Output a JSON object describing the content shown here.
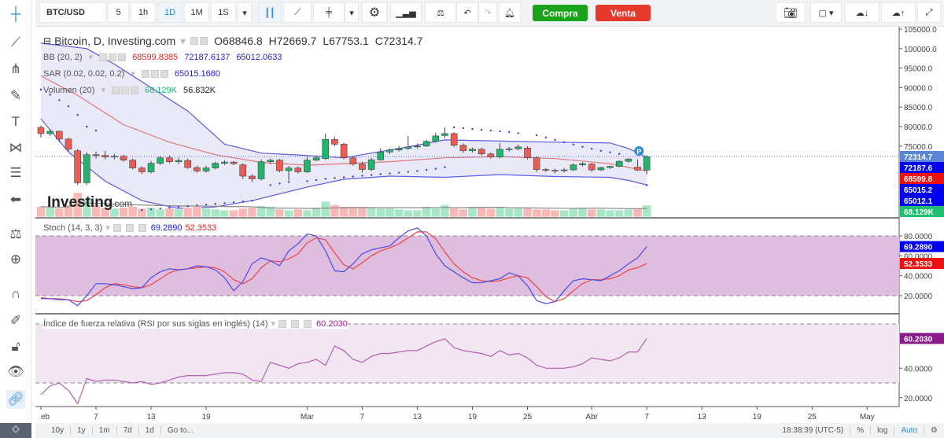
{
  "toolbar": {
    "symbol": "BTC/USD",
    "intervals": [
      "5",
      "1h",
      "1D",
      "1M",
      "1S"
    ],
    "active_interval": "1D",
    "buy_label": "Compra",
    "sell_label": "Venta"
  },
  "legend": {
    "title": "Bitcoin, D, Investing.com",
    "open": "O68846.8",
    "high": "H72669.7",
    "low": "L67753.1",
    "close": "C72314.7",
    "bb": {
      "label": "BB (20, 2)",
      "middle": "68599.8385",
      "upper": "72187.6137",
      "lower": "65012.0633"
    },
    "sar": {
      "label": "SAR (0.02, 0.02, 0.2)",
      "value": "65015.1680"
    },
    "volume": {
      "label": "Volumen (20)",
      "value": "68.129K",
      "ma": "56.832K"
    }
  },
  "stoch": {
    "label": "Stoch (14, 3, 3)",
    "k": "69.2890",
    "d": "52.3533",
    "axis": [
      "80.0000",
      "60.0000",
      "40.0000",
      "20.0000"
    ]
  },
  "rsi": {
    "label": "Índice de fuerza relativa (RSI por sus siglas en inglés) (14)",
    "value": "60.2030",
    "axis": [
      "40.0000",
      "20.0000"
    ]
  },
  "price_axis": {
    "ticks": [
      "105000.0",
      "100000.0",
      "95000.0",
      "90000.0",
      "85000.0",
      "80000.0",
      "75000.0"
    ],
    "labels": [
      {
        "text": "72314.7",
        "value": 72314.7,
        "color": "#5b86d8"
      },
      {
        "text": "72187.6",
        "value": 72187.6,
        "color": "#0000ee"
      },
      {
        "text": "68599.8",
        "value": 68599.8,
        "color": "#ee1111"
      },
      {
        "text": "65015.2",
        "value": 65015.2,
        "color": "#0000ee"
      },
      {
        "text": "65012.1",
        "value": 65012.1,
        "color": "#0000ee"
      }
    ],
    "volume_label": {
      "text": "68.129K",
      "color": "#1fbf72"
    }
  },
  "date_axis": [
    {
      "label": "eb",
      "date": "Feb 1"
    },
    {
      "label": "7",
      "date": "Feb 7"
    },
    {
      "label": "13",
      "date": "Feb 13"
    },
    {
      "label": "19",
      "date": "Feb 19"
    },
    {
      "label": "Mar",
      "date": "Mar 1"
    },
    {
      "label": "7",
      "date": "Mar 7"
    },
    {
      "label": "13",
      "date": "Mar 13"
    },
    {
      "label": "19",
      "date": "Mar 19"
    },
    {
      "label": "25",
      "date": "Mar 25"
    },
    {
      "label": "Abr",
      "date": "Apr 1"
    },
    {
      "label": "7",
      "date": "Apr 7"
    },
    {
      "label": "13",
      "date": "Apr 13"
    },
    {
      "label": "19",
      "date": "Apr 19"
    },
    {
      "label": "25",
      "date": "Apr 25"
    },
    {
      "label": "May",
      "date": "May 1"
    }
  ],
  "bottom": {
    "ranges": [
      "10y",
      "1y",
      "1m",
      "7d",
      "1d",
      "Go to..."
    ],
    "time": "18:38:39 (UTC-5)",
    "percent": "%",
    "log": "log",
    "auto": "Auto"
  },
  "colors": {
    "up": "#21b46b",
    "down": "#ee5b55",
    "bb_band": "#5a5ae6",
    "bb_mid": "#e07a7a",
    "sar": "#3a3adf",
    "stoch_k": "#4a4ae8",
    "stoch_d": "#ee4444",
    "rsi": "#b060b0"
  },
  "chart_data": {
    "type": "candlestick",
    "candles": [
      [
        "Feb 1",
        79800,
        80300,
        77200,
        78200
      ],
      [
        "Feb 2",
        78200,
        79400,
        77600,
        78800
      ],
      [
        "Feb 3",
        78800,
        79000,
        76000,
        76800
      ],
      [
        "Feb 4",
        76800,
        77200,
        73400,
        74200
      ],
      [
        "Feb 5",
        73800,
        74200,
        65000,
        65600
      ],
      [
        "Feb 6",
        65600,
        73400,
        65000,
        72800
      ],
      [
        "Feb 7",
        72800,
        73600,
        71800,
        72600
      ],
      [
        "Feb 8",
        72600,
        73800,
        71600,
        72200
      ],
      [
        "Feb 9",
        72200,
        73000,
        71600,
        72400
      ],
      [
        "Feb 10",
        72400,
        72800,
        71000,
        71400
      ],
      [
        "Feb 11",
        71400,
        71800,
        69000,
        69400
      ],
      [
        "Feb 12",
        69400,
        69800,
        67800,
        68400
      ],
      [
        "Feb 13",
        68400,
        71200,
        68000,
        70600
      ],
      [
        "Feb 14",
        70600,
        72400,
        70200,
        72000
      ],
      [
        "Feb 15",
        72000,
        72600,
        70600,
        71000
      ],
      [
        "Feb 16",
        71000,
        72000,
        70400,
        71300
      ],
      [
        "Feb 17",
        71300,
        71800,
        69200,
        69500
      ],
      [
        "Feb 18",
        69500,
        70000,
        68200,
        68600
      ],
      [
        "Feb 19",
        68600,
        70000,
        68200,
        69400
      ],
      [
        "Feb 20",
        69400,
        71000,
        69000,
        70600
      ],
      [
        "Feb 21",
        70600,
        71400,
        70200,
        70900
      ],
      [
        "Feb 22",
        70900,
        71200,
        70100,
        70500
      ],
      [
        "Feb 23",
        70200,
        70600,
        66600,
        67300
      ],
      [
        "Feb 24",
        67300,
        67800,
        65800,
        66600
      ],
      [
        "Feb 25",
        66600,
        71600,
        66200,
        71000
      ],
      [
        "Feb 26",
        71000,
        71800,
        70400,
        71400
      ],
      [
        "Feb 27",
        71400,
        71700,
        68300,
        68700
      ],
      [
        "Feb 28",
        68700,
        69900,
        66200,
        69400
      ],
      [
        "Feb 29",
        69400,
        69800,
        68000,
        68400
      ],
      [
        "Mar 1",
        68400,
        72400,
        68100,
        71400
      ],
      [
        "Mar 2",
        71400,
        72600,
        71200,
        72000
      ],
      [
        "Mar 3",
        71800,
        78200,
        71400,
        76700
      ],
      [
        "Mar 4",
        76700,
        77400,
        75000,
        75500
      ],
      [
        "Mar 5",
        75500,
        75900,
        71600,
        72000
      ],
      [
        "Mar 6",
        72000,
        72400,
        70000,
        70400
      ],
      [
        "Mar 7",
        70400,
        71000,
        68200,
        69000
      ],
      [
        "Mar 8",
        69000,
        72000,
        68600,
        71500
      ],
      [
        "Mar 9",
        71500,
        74400,
        71200,
        73500
      ],
      [
        "Mar 10",
        73500,
        74400,
        73000,
        74000
      ],
      [
        "Mar 11",
        74000,
        75000,
        73600,
        74400
      ],
      [
        "Mar 12",
        74400,
        77600,
        74000,
        74800
      ],
      [
        "Mar 13",
        74800,
        75600,
        74400,
        75000
      ],
      [
        "Mar 14",
        75000,
        76600,
        74800,
        76200
      ],
      [
        "Mar 15",
        76200,
        78400,
        76000,
        77600
      ],
      [
        "Mar 16",
        77700,
        79800,
        77000,
        78200
      ],
      [
        "Mar 17",
        78200,
        78600,
        74800,
        75200
      ],
      [
        "Mar 18",
        75200,
        75600,
        73200,
        73800
      ],
      [
        "Mar 19",
        73800,
        74600,
        73400,
        74200
      ],
      [
        "Mar 20",
        74200,
        74600,
        72600,
        73000
      ],
      [
        "Mar 21",
        73000,
        73400,
        71800,
        72200
      ],
      [
        "Mar 22",
        72200,
        75800,
        71800,
        74200
      ],
      [
        "Mar 23",
        74200,
        74800,
        73600,
        74300
      ],
      [
        "Mar 24",
        74300,
        75400,
        74000,
        74800
      ],
      [
        "Mar 25",
        74500,
        75000,
        71600,
        72000
      ],
      [
        "Mar 26",
        72000,
        72400,
        68400,
        69000
      ],
      [
        "Mar 27",
        69000,
        69400,
        68400,
        68800
      ],
      [
        "Mar 28",
        68800,
        69200,
        68000,
        68700
      ],
      [
        "Mar 29",
        68700,
        69400,
        68200,
        68900
      ],
      [
        "Mar 30",
        68900,
        70600,
        68600,
        70200
      ],
      [
        "Mar 31",
        70200,
        70900,
        69800,
        70500
      ],
      [
        "Apr 1",
        70400,
        70700,
        68400,
        68900
      ],
      [
        "Apr 2",
        68900,
        69700,
        68700,
        69500
      ],
      [
        "Apr 3",
        69500,
        70000,
        69200,
        69800
      ],
      [
        "Apr 4",
        69800,
        71400,
        69600,
        71100
      ],
      [
        "Apr 5",
        71100,
        71900,
        70800,
        71700
      ],
      [
        "Apr 6",
        69600,
        71600,
        68600,
        68850
      ],
      [
        "Apr 7",
        68846.8,
        72669.7,
        67753.1,
        72314.7
      ]
    ],
    "volume_k": [
      60,
      55,
      50,
      70,
      140,
      110,
      70,
      55,
      50,
      55,
      60,
      50,
      55,
      45,
      50,
      45,
      55,
      60,
      50,
      45,
      40,
      40,
      50,
      55,
      65,
      60,
      45,
      40,
      45,
      40,
      55,
      90,
      70,
      60,
      60,
      60,
      55,
      50,
      50,
      45,
      40,
      40,
      60,
      50,
      70,
      50,
      45,
      60,
      55,
      50,
      60,
      50,
      50,
      55,
      45,
      45,
      40,
      40,
      50,
      55,
      45,
      45,
      40,
      40,
      45,
      50,
      68.129
    ],
    "bb_upper": [
      [
        "Feb 1",
        101400
      ],
      [
        "Feb 6",
        100000
      ],
      [
        "Feb 9",
        96000
      ],
      [
        "Feb 13",
        90000
      ],
      [
        "Feb 17",
        84000
      ],
      [
        "Feb 21",
        75500
      ],
      [
        "Feb 25",
        73200
      ],
      [
        "Mar 1",
        72600
      ],
      [
        "Mar 5",
        72000
      ],
      [
        "Mar 8",
        73200
      ],
      [
        "Mar 12",
        74800
      ],
      [
        "Mar 16",
        76600
      ],
      [
        "Mar 22",
        76300
      ],
      [
        "Mar 28",
        76000
      ],
      [
        "Apr 3",
        75800
      ],
      [
        "Apr 5",
        74400
      ],
      [
        "Apr 7",
        72187.6
      ]
    ],
    "bb_middle": [
      [
        "Feb 1",
        93000
      ],
      [
        "Feb 5",
        88000
      ],
      [
        "Feb 10",
        80500
      ],
      [
        "Feb 15",
        76000
      ],
      [
        "Feb 20",
        72800
      ],
      [
        "Feb 25",
        70800
      ],
      [
        "Mar 1",
        70100
      ],
      [
        "Mar 5",
        70500
      ],
      [
        "Mar 10",
        71000
      ],
      [
        "Mar 16",
        72000
      ],
      [
        "Mar 22",
        72300
      ],
      [
        "Mar 28",
        71800
      ],
      [
        "Apr 3",
        70500
      ],
      [
        "Apr 7",
        68599.8
      ]
    ],
    "bb_lower": [
      [
        "Feb 1",
        82000
      ],
      [
        "Feb 4",
        73500
      ],
      [
        "Feb 8",
        66000
      ],
      [
        "Feb 12",
        61000
      ],
      [
        "Feb 16",
        59000
      ],
      [
        "Feb 20",
        59400
      ],
      [
        "Feb 24",
        61000
      ],
      [
        "Mar 1",
        64500
      ],
      [
        "Mar 5",
        66500
      ],
      [
        "Mar 10",
        67300
      ],
      [
        "Mar 16",
        67000
      ],
      [
        "Mar 22",
        67700
      ],
      [
        "Mar 28",
        67200
      ],
      [
        "Apr 3",
        67000
      ],
      [
        "Apr 5",
        66200
      ],
      [
        "Apr 7",
        65012.1
      ]
    ],
    "sar": [
      [
        "Feb 1",
        89500
      ],
      [
        "Feb 2",
        88200
      ],
      [
        "Feb 3",
        86800
      ],
      [
        "Feb 4",
        85200
      ],
      [
        "Feb 5",
        83000
      ],
      [
        "Feb 6",
        80000
      ],
      [
        "Feb 7",
        79000
      ],
      [
        "Feb 12",
        58600
      ],
      [
        "Feb 13",
        58800
      ],
      [
        "Feb 14",
        59000
      ],
      [
        "Feb 15",
        59200
      ],
      [
        "Feb 16",
        59400
      ],
      [
        "Feb 17",
        59600
      ],
      [
        "Feb 18",
        59800
      ],
      [
        "Feb 19",
        60000
      ],
      [
        "Feb 20",
        60200
      ],
      [
        "Feb 21",
        60400
      ],
      [
        "Feb 22",
        60600
      ],
      [
        "Feb 23",
        60800
      ],
      [
        "Feb 24",
        61000
      ],
      [
        "Feb 26",
        65000
      ],
      [
        "Feb 27",
        65400
      ],
      [
        "Feb 28",
        65800
      ],
      [
        "Mar 1",
        66000
      ],
      [
        "Mar 2",
        66300
      ],
      [
        "Mar 3",
        66600
      ],
      [
        "Mar 4",
        66800
      ],
      [
        "Mar 5",
        67000
      ],
      [
        "Mar 6",
        67200
      ],
      [
        "Mar 7",
        67400
      ],
      [
        "Mar 8",
        67600
      ],
      [
        "Mar 9",
        67800
      ],
      [
        "Mar 10",
        68000
      ],
      [
        "Mar 11",
        68200
      ],
      [
        "Mar 12",
        68400
      ],
      [
        "Mar 13",
        68600
      ],
      [
        "Mar 14",
        68900
      ],
      [
        "Mar 15",
        69200
      ],
      [
        "Mar 16",
        69600
      ],
      [
        "Mar 17",
        79800
      ],
      [
        "Mar 18",
        79600
      ],
      [
        "Mar 19",
        79400
      ],
      [
        "Mar 20",
        79200
      ],
      [
        "Mar 21",
        79000
      ],
      [
        "Mar 22",
        78800
      ],
      [
        "Mar 23",
        78600
      ],
      [
        "Mar 24",
        78300
      ],
      [
        "Mar 26",
        77800
      ],
      [
        "Mar 27",
        77200
      ],
      [
        "Mar 28",
        76600
      ],
      [
        "Mar 29",
        76000
      ],
      [
        "Mar 30",
        75400
      ],
      [
        "Mar 31",
        74800
      ],
      [
        "Apr 1",
        74300
      ],
      [
        "Apr 2",
        73800
      ],
      [
        "Apr 3",
        73400
      ],
      [
        "Apr 4",
        73000
      ],
      [
        "Apr 7",
        65015.2
      ]
    ],
    "stoch_k": [
      17,
      17,
      16,
      16,
      10,
      20,
      32,
      32,
      31,
      29,
      27,
      28,
      38,
      44,
      47,
      46,
      47,
      50,
      49,
      46,
      38,
      25,
      34,
      52,
      58,
      55,
      50,
      65,
      72,
      82,
      80,
      65,
      45,
      44,
      52,
      62,
      66,
      68,
      70,
      78,
      85,
      88,
      80,
      62,
      50,
      44,
      38,
      33,
      33,
      35,
      37,
      43,
      40,
      30,
      15,
      12,
      14,
      25,
      35,
      37,
      36,
      35,
      40,
      45,
      52,
      58,
      69.29
    ],
    "stoch_d": [
      18,
      17,
      17,
      16,
      14,
      15,
      21,
      28,
      32,
      31,
      29,
      28,
      31,
      37,
      43,
      46,
      47,
      48,
      49,
      48,
      44,
      36,
      32,
      37,
      48,
      55,
      54,
      57,
      62,
      73,
      78,
      76,
      63,
      51,
      47,
      53,
      60,
      65,
      68,
      72,
      78,
      84,
      84,
      77,
      64,
      52,
      44,
      38,
      35,
      34,
      35,
      38,
      40,
      38,
      29,
      19,
      14,
      17,
      25,
      32,
      36,
      36,
      37,
      40,
      46,
      48,
      52.35
    ],
    "stoch_bands": [
      80,
      20
    ],
    "rsi": [
      22,
      28,
      30,
      25,
      16,
      33,
      31,
      32,
      32,
      31,
      30,
      31,
      29,
      30,
      32,
      34,
      35,
      35,
      35,
      36,
      37,
      37,
      36,
      32,
      31,
      44,
      42,
      40,
      43,
      44,
      46,
      42,
      55,
      52,
      46,
      44,
      48,
      50,
      50,
      51,
      52,
      52,
      55,
      58,
      60,
      54,
      52,
      51,
      50,
      48,
      52,
      49,
      50,
      47,
      42,
      40,
      40,
      40,
      41,
      43,
      47,
      46,
      45,
      47,
      51,
      51,
      60.2
    ],
    "rsi_bands": [
      70,
      30
    ],
    "last_price": 72314.7,
    "price_range": [
      56000,
      106000
    ]
  }
}
